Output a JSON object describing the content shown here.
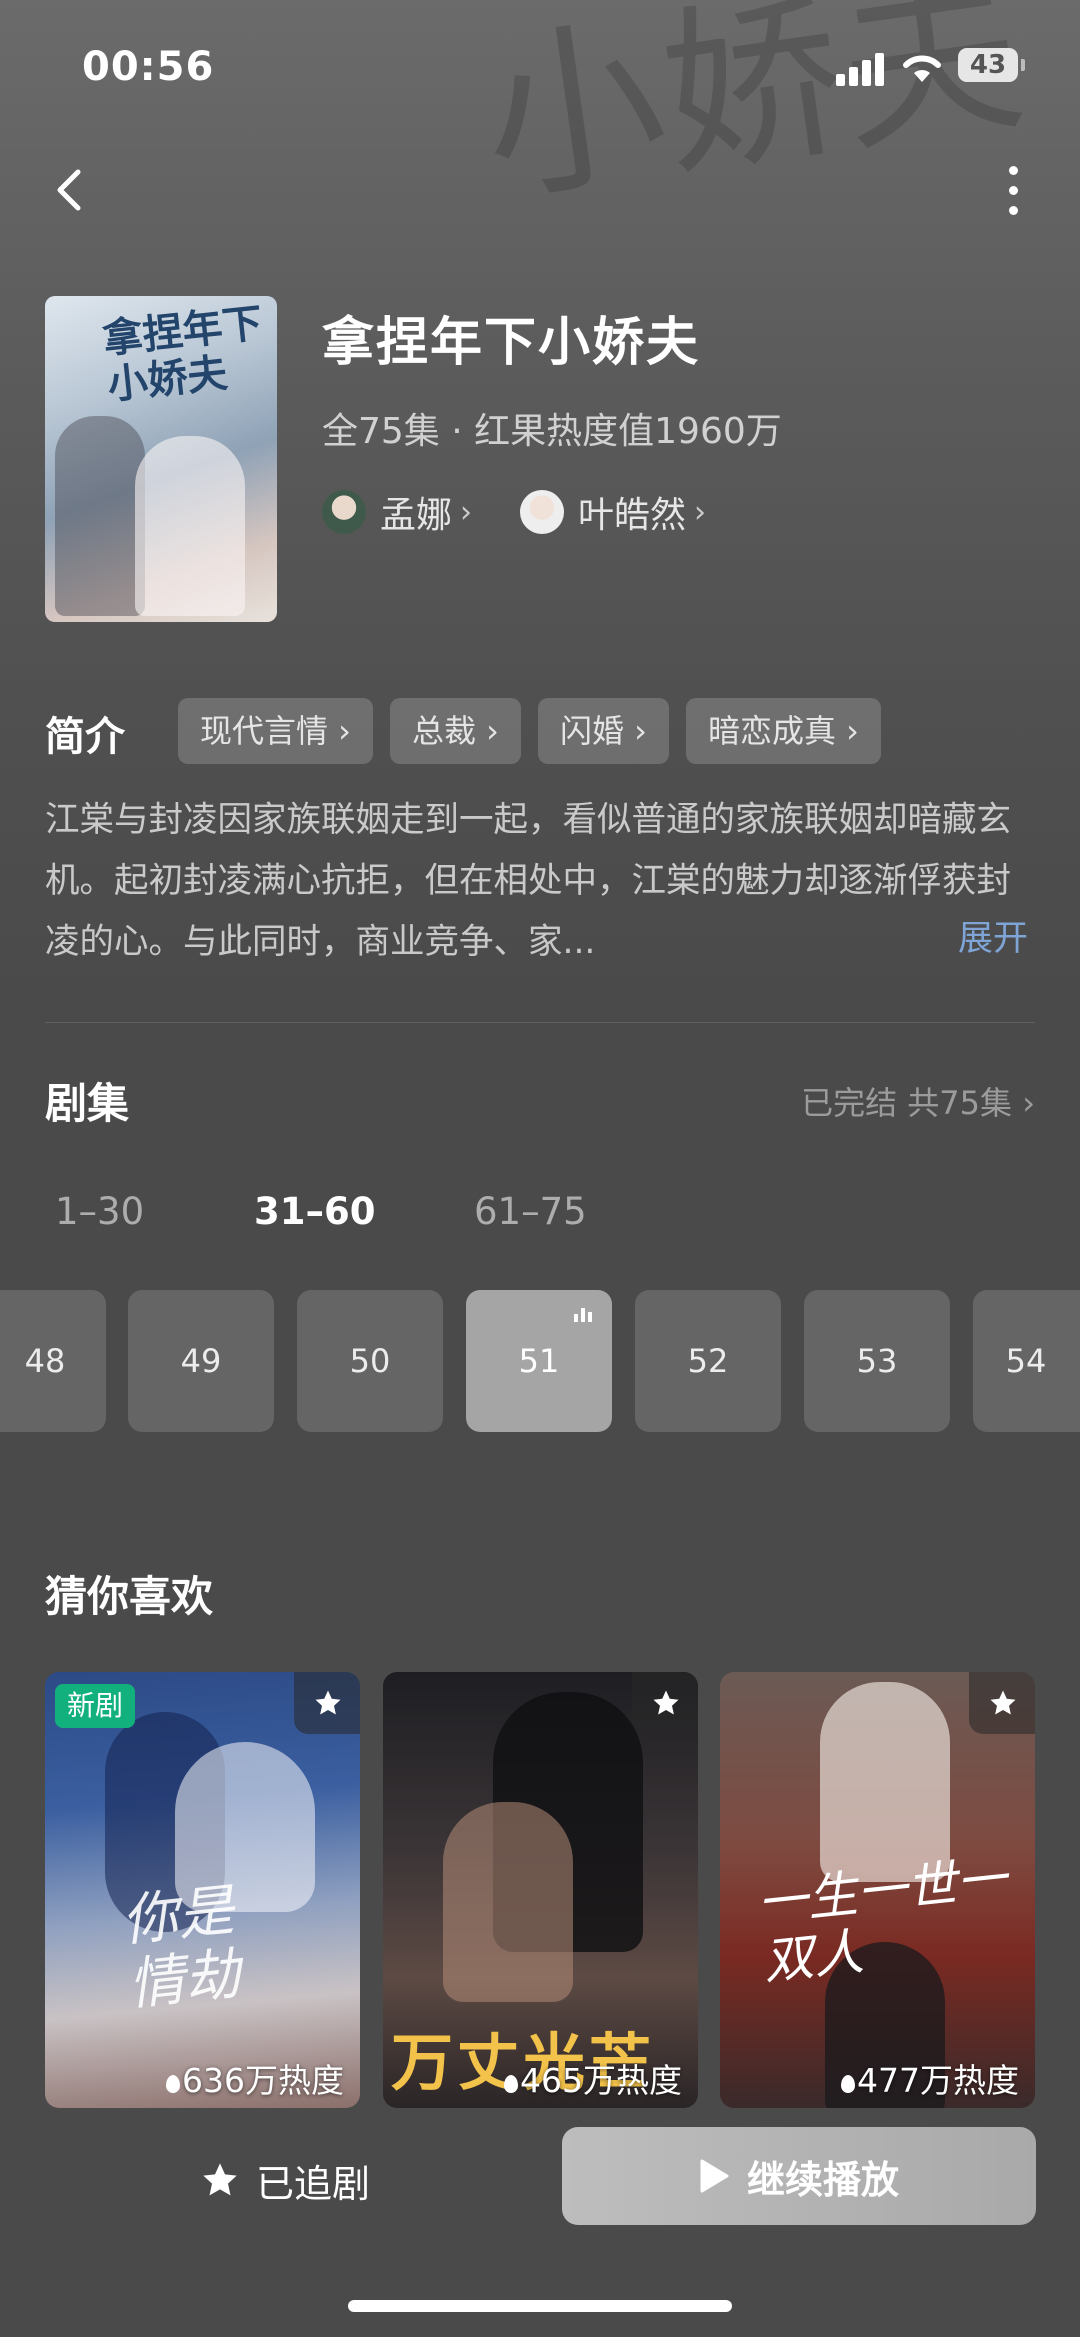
{
  "status_bar": {
    "time": "00:56",
    "battery": "43"
  },
  "drama": {
    "title": "拿捏年下小娇夫",
    "meta": "全75集 · 红果热度值1960万",
    "poster_title": "拿捏年下小娇夫",
    "actors": [
      {
        "name": "孟娜"
      },
      {
        "name": "叶皓然"
      }
    ]
  },
  "intro": {
    "heading": "简介",
    "tags": [
      "现代言情 ›",
      "总裁 ›",
      "闪婚 ›",
      "暗恋成真 ›"
    ],
    "description": "江棠与封凌因家族联姻走到一起，看似普通的家族联姻却暗藏玄机。起初封凌满心抗拒，但在相处中，江棠的魅力却逐渐俘获封凌的心。与此同时，商业竞争、家...",
    "expand_label": "展开"
  },
  "episodes": {
    "heading": "剧集",
    "status": "已完结 共75集 ›",
    "ranges": [
      "1–30",
      "31–60",
      "61–75"
    ],
    "selected_range": "31–60",
    "items": [
      "48",
      "49",
      "50",
      "51",
      "52",
      "53",
      "54"
    ],
    "current": "51"
  },
  "recommend": {
    "heading": "猜你喜欢",
    "cards": [
      {
        "badge": "新剧",
        "heat": "636万热度",
        "poster_text": "你是情劫"
      },
      {
        "heat": "465万热度",
        "poster_text": "万丈光芒"
      },
      {
        "heat": "477万热度",
        "poster_text": "一生一世一双人"
      }
    ]
  },
  "bottom_bar": {
    "follow_label": "已追剧",
    "play_label": "继续播放"
  },
  "colors": {
    "accent_link": "#7fa4d6",
    "badge_green": "#12b07d",
    "background": "#4a4a4a"
  },
  "icons": [
    "back-icon",
    "more-icon",
    "star-icon",
    "play-icon",
    "signal-icon",
    "wifi-icon",
    "battery-icon",
    "flame-icon"
  ]
}
